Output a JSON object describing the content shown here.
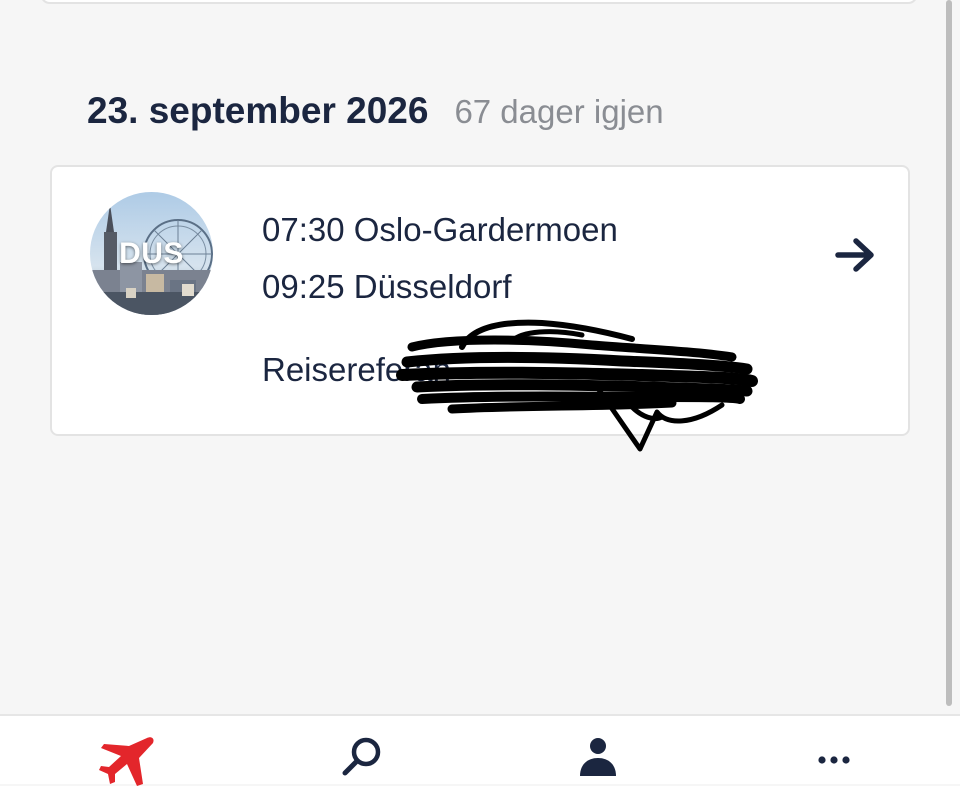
{
  "trip": {
    "date": "23. september 2026",
    "days_left": "67 dager igjen",
    "destination_code": "DUS",
    "departure": "07:30 Oslo-Gardermoen",
    "arrival": "09:25 Düsseldorf",
    "reference_label": "Reisereferan"
  },
  "icons": {
    "open_trip": "arrow-right-icon",
    "redaction": "scribble-redaction",
    "nav_trips": "airplane-icon",
    "nav_search": "search-icon",
    "nav_profile": "person-icon",
    "nav_more": "more-dots-icon"
  },
  "colors": {
    "text_primary": "#1b2640",
    "text_secondary": "#8a8d93",
    "accent_red": "#e3262b",
    "background": "#f6f6f6"
  }
}
